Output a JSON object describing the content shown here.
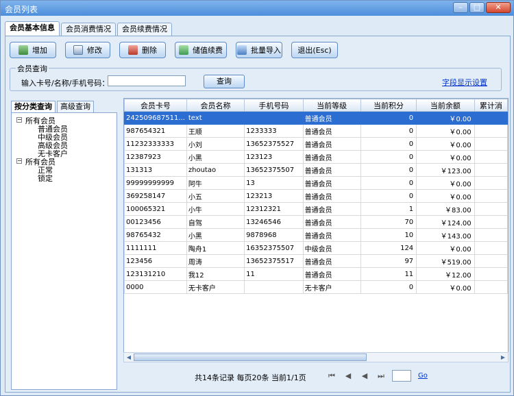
{
  "window": {
    "title": "会员列表"
  },
  "tabs": [
    "会员基本信息",
    "会员消费情况",
    "会员续费情况"
  ],
  "toolbar": {
    "add": "增加",
    "edit": "修改",
    "delete": "删除",
    "recharge": "储值续费",
    "import": "批量导入",
    "exit": "退出(Esc)"
  },
  "search": {
    "group_title": "会员查询",
    "label": "输入卡号/名称/手机号码：",
    "value": "",
    "button": "查询",
    "field_link": "字段显示设置"
  },
  "left_tabs": [
    "按分类查询",
    "高级查询"
  ],
  "tree": {
    "root1": "所有会员",
    "children1": [
      "普通会员",
      "中级会员",
      "高级会员",
      "无卡客户"
    ],
    "root2": "所有会员",
    "children2": [
      "正常",
      "锁定"
    ]
  },
  "grid": {
    "columns": [
      "会员卡号",
      "会员名称",
      "手机号码",
      "当前等级",
      "当前积分",
      "当前余额",
      "累计消"
    ],
    "rows": [
      [
        "242509687511...",
        "text",
        "",
        "普通会员",
        "0",
        "￥0.00"
      ],
      [
        "987654321",
        "王顺",
        "1233333",
        "普通会员",
        "0",
        "￥0.00"
      ],
      [
        "11232333333",
        "小刘",
        "13652375527",
        "普通会员",
        "0",
        "￥0.00"
      ],
      [
        "12387923",
        "小黑",
        "123123",
        "普通会员",
        "0",
        "￥0.00"
      ],
      [
        "131313",
        "zhoutao",
        "13652375507",
        "普通会员",
        "0",
        "￥123.00"
      ],
      [
        "99999999999",
        "阿牛",
        "13",
        "普通会员",
        "0",
        "￥0.00"
      ],
      [
        "369258147",
        "小五",
        "123213",
        "普通会员",
        "0",
        "￥0.00"
      ],
      [
        "100065321",
        "小牛",
        "12312321",
        "普通会员",
        "1",
        "￥83.00"
      ],
      [
        "00123456",
        "自驾",
        "13246546",
        "普通会员",
        "70",
        "￥124.00"
      ],
      [
        "98765432",
        "小黑",
        "9878968",
        "普通会员",
        "10",
        "￥143.00"
      ],
      [
        "1111111",
        "陶舟1",
        "16352375507",
        "中级会员",
        "124",
        "￥0.00"
      ],
      [
        "123456",
        "周涛",
        "13652375517",
        "普通会员",
        "97",
        "￥519.00"
      ],
      [
        "123131210",
        "我12",
        "11",
        "普通会员",
        "11",
        "￥12.00"
      ],
      [
        "0000",
        "无卡客户",
        "",
        "无卡客户",
        "0",
        "￥0.00"
      ]
    ]
  },
  "status": {
    "summary": "共14条记录 每页20条 当前1/1页"
  },
  "pager": {
    "first": "⏮",
    "prev": "◀",
    "next": "◀",
    "last": "⏭",
    "page_value": "",
    "go": "Go"
  }
}
